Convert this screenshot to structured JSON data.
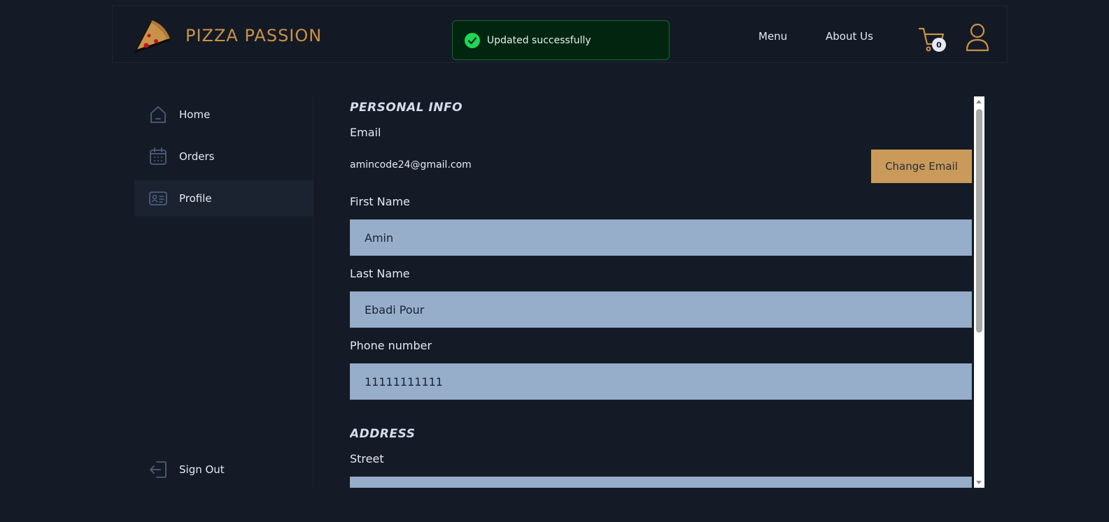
{
  "header": {
    "brand": "PIZZA PASSION",
    "toast": "Updated successfully",
    "nav": {
      "menu": "Menu",
      "about": "About Us"
    },
    "cart_count": "0"
  },
  "sidebar": {
    "items": [
      {
        "label": "Home",
        "icon": "home-icon"
      },
      {
        "label": "Orders",
        "icon": "calendar-icon"
      },
      {
        "label": "Profile",
        "icon": "id-card-icon",
        "active": true
      }
    ],
    "signout": "Sign Out"
  },
  "profile": {
    "personal_title": "PERSONAL INFO",
    "email_label": "Email",
    "email_value": "amincode24@gmail.com",
    "change_email": "Change Email",
    "first_name_label": "First Name",
    "first_name": "Amin",
    "last_name_label": "Last Name",
    "last_name": "Ebadi Pour",
    "phone_label": "Phone number",
    "phone": "11111111111",
    "address_title": "ADDRESS",
    "street_label": "Street"
  },
  "colors": {
    "background": "#151b26",
    "accent": "#c9924a",
    "button": "#c99a5a",
    "input": "#97aecb",
    "toast_bg": "#01250f",
    "toast_check": "#1fd655"
  }
}
